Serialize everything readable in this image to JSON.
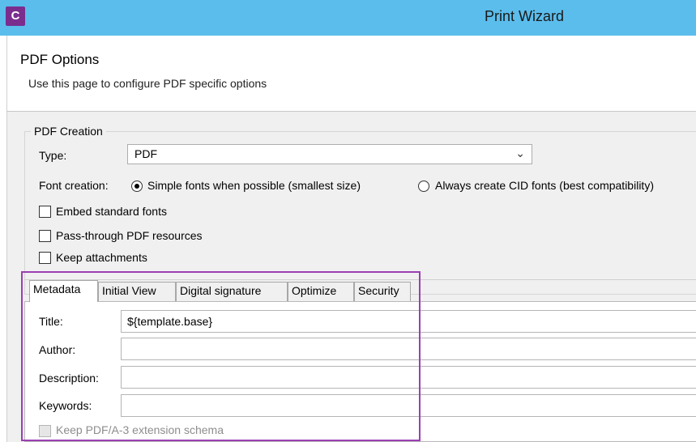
{
  "window": {
    "app_icon_letter": "C",
    "title": "Print Wizard"
  },
  "header": {
    "title": "PDF Options",
    "description": "Use this page to configure PDF specific options"
  },
  "pdf_creation": {
    "group_title": "PDF Creation",
    "type_label": "Type:",
    "type_value": "PDF",
    "font_creation_label": "Font creation:",
    "font_options": [
      {
        "label": "Simple fonts when possible (smallest size)",
        "selected": true
      },
      {
        "label": "Always create CID fonts (best compatibility)",
        "selected": false
      }
    ],
    "checkboxes": [
      {
        "label": "Embed standard fonts",
        "checked": false
      },
      {
        "label": "Pass-through PDF resources",
        "checked": false
      },
      {
        "label": "Keep attachments",
        "checked": false
      }
    ]
  },
  "tabs": [
    {
      "label": "Metadata",
      "active": true
    },
    {
      "label": "Initial View",
      "active": false
    },
    {
      "label": "Digital signature",
      "active": false
    },
    {
      "label": "Optimize",
      "active": false
    },
    {
      "label": "Security",
      "active": false
    }
  ],
  "metadata": {
    "title_label": "Title:",
    "title_value": "${template.base}",
    "author_label": "Author:",
    "author_value": "",
    "description_label": "Description:",
    "description_value": "",
    "keywords_label": "Keywords:",
    "keywords_value": "",
    "pdfa3_label": "Keep PDF/A-3 extension schema",
    "pdfa3_checked": false
  },
  "colors": {
    "titlebar": "#5bbdec",
    "app_icon": "#7b2d8e",
    "highlight": "#9b3fb3"
  }
}
